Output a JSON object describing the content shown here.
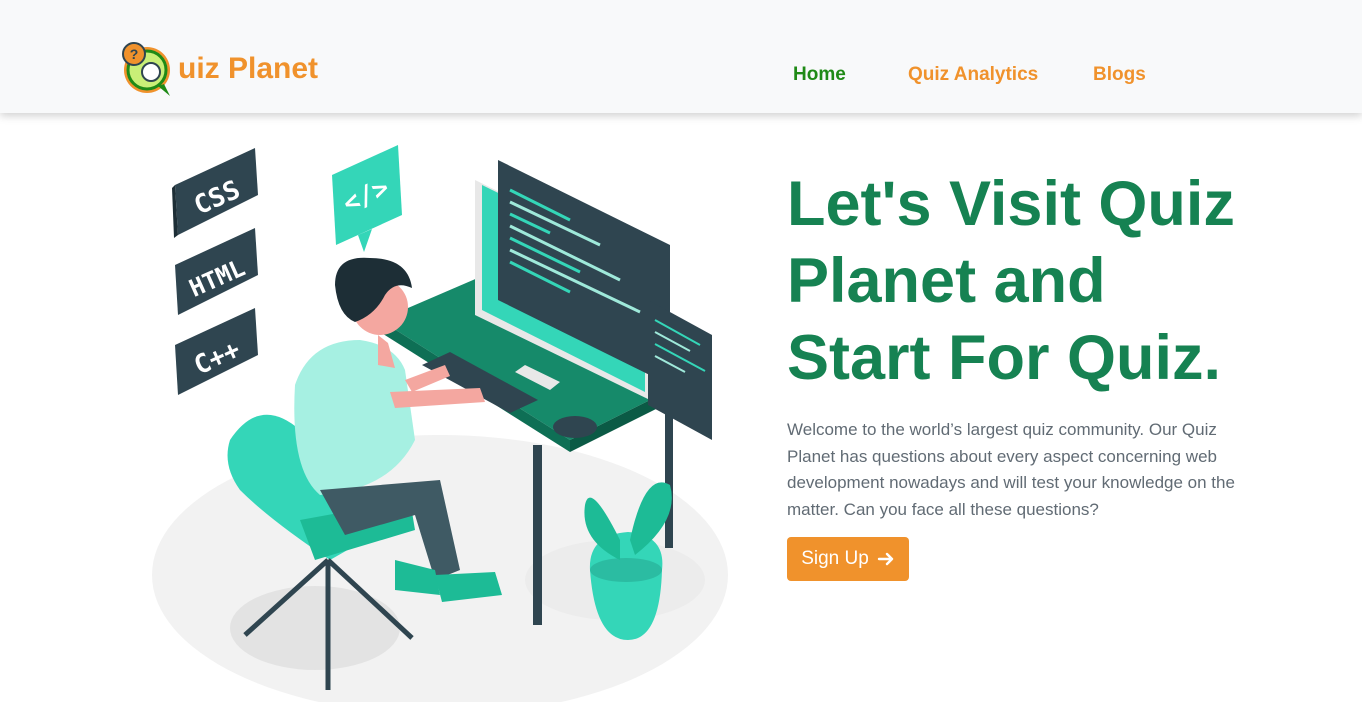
{
  "nav": {
    "logo_text": "uiz Planet",
    "links": [
      {
        "label": "Home",
        "active": true
      },
      {
        "label": "Quiz Analytics",
        "active": false
      },
      {
        "label": "Blogs",
        "active": false
      }
    ]
  },
  "hero": {
    "title_lines": [
      "Let's Visit Quiz",
      "Planet and",
      "Start For Quiz."
    ],
    "description": "Welcome to the world’s largest quiz community. Our Quiz Planet has questions about every aspect concerning web development nowadays and will test your knowledge on the matter. Can you face all these questions?",
    "cta_label": "Sign Up",
    "illustration": {
      "code_badges": [
        "CSS",
        "HTML",
        "C++"
      ],
      "speech_bubble": "</>"
    }
  },
  "colors": {
    "brand_orange": "#f0922c",
    "brand_green": "#168252",
    "nav_active_green": "#1f8a16",
    "teal_accent": "#34d6b8",
    "dark_slate": "#2f4550"
  },
  "icons": [
    "quiz-planet-logo-icon",
    "arrow-right-icon"
  ]
}
